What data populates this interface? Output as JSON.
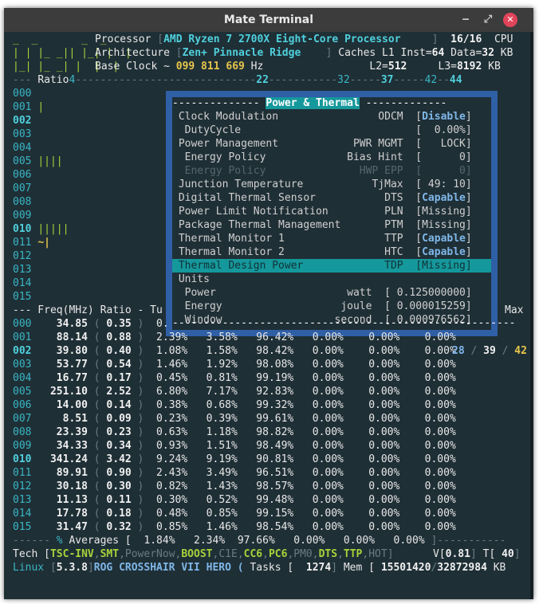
{
  "window": {
    "title": "Mate Terminal"
  },
  "header": {
    "logo": [
      "_  _       _  _",
      "| | |_ _|| |_| |  |",
      "|_| |_ _| |  |  |"
    ],
    "processor_label": "Processor",
    "processor": "AMD Ryzen 7 2700X Eight-Core Processor",
    "threads": "16/16",
    "cpu_label": "CPU",
    "arch_label": "Architecture",
    "arch": "Zen+ Pinnacle Ridge",
    "caches_label": "Caches L1 Inst=",
    "l1i": "64",
    "data_label": "Data=",
    "l1d": "32",
    "kb": "KB",
    "clock_label": "Base Clock ~",
    "clock": "099 811 669",
    "hz": "Hz",
    "l2_label": "L2=",
    "l2": "512",
    "l3_label": "L3=",
    "l3": "8192"
  },
  "ratio_bar": {
    "label": "Ratio",
    "r4": "4",
    "r22": "22",
    "r32": "32",
    "r37": "37",
    "r42": "42",
    "r44": "44"
  },
  "core_rows": [
    {
      "id": "000",
      "bar": ""
    },
    {
      "id": "001",
      "bar": "|"
    },
    {
      "id": "002",
      "bar": ""
    },
    {
      "id": "003",
      "bar": ""
    },
    {
      "id": "004",
      "bar": ""
    },
    {
      "id": "005",
      "bar": "||||"
    },
    {
      "id": "006",
      "bar": ""
    },
    {
      "id": "007",
      "bar": ""
    },
    {
      "id": "008",
      "bar": ""
    },
    {
      "id": "009",
      "bar": ""
    },
    {
      "id": "010",
      "bar": "|||||"
    },
    {
      "id": "011",
      "bar": "~|"
    },
    {
      "id": "012",
      "bar": ""
    },
    {
      "id": "013",
      "bar": ""
    },
    {
      "id": "014",
      "bar": ""
    },
    {
      "id": "015",
      "bar": ""
    }
  ],
  "panel": {
    "title": "Power & Thermal",
    "rows": [
      {
        "label": "Clock Modulation",
        "key": "ODCM",
        "value": "Disable",
        "type": "cap"
      },
      {
        "label": " DutyCycle",
        "key": "",
        "value": "  0.00%",
        "type": "plain"
      },
      {
        "label": "Power Management",
        "key": "PWR MGMT",
        "value": "   LOCK",
        "type": "plain"
      },
      {
        "label": " Energy Policy",
        "key": "Bias Hint",
        "value": "      0",
        "type": "plain"
      },
      {
        "label": " Energy Policy",
        "key": "HWP EPP",
        "value": "      0",
        "type": "dim"
      },
      {
        "label": "Junction Temperature",
        "key": "TjMax",
        "value": " 49: 10",
        "type": "plain"
      },
      {
        "label": "Digital Thermal Sensor",
        "key": "DTS",
        "value": "Capable",
        "type": "cap"
      },
      {
        "label": "Power Limit Notification",
        "key": "PLN",
        "value": "Missing",
        "type": "plain"
      },
      {
        "label": "Package Thermal Management",
        "key": "PTM",
        "value": "Missing",
        "type": "plain"
      },
      {
        "label": "Thermal Monitor 1",
        "key": "TTP",
        "value": "Capable",
        "type": "cap"
      },
      {
        "label": "Thermal Monitor 2",
        "key": "HTC",
        "value": "Capable",
        "type": "cap"
      },
      {
        "label": "Thermal Design Power",
        "key": "TDP",
        "value": "Missing",
        "type": "sel"
      }
    ],
    "units_label": "Units",
    "units": [
      {
        "label": " Power",
        "unit": "watt",
        "value": " 0.125000000"
      },
      {
        "label": " Energy",
        "unit": "joule",
        "value": " 0.000015259"
      },
      {
        "label": " Window",
        "unit": "second",
        "value": " 0.000976562"
      }
    ]
  },
  "freq_header": {
    "text": "--- Freq(MHz) Ratio - Tu",
    "max": "Max"
  },
  "freq_rows": [
    {
      "id": "000",
      "mhz": "34.85",
      "ratio": "0.35",
      "c0": "0.",
      "c1": "",
      "c3": "",
      "c6": "",
      "c7": "",
      "p1": "",
      "p2": "",
      "p3": ""
    },
    {
      "id": "001",
      "mhz": "88.14",
      "ratio": "0.88",
      "c0": "2.39%",
      "c1": "3.58%",
      "c3": "96.42%",
      "c6": "0.00%",
      "c7": "0.00%",
      "p1": "0.00%"
    },
    {
      "id": "002",
      "mhz": "39.80",
      "ratio": "0.40",
      "c0": "1.08%",
      "c1": "1.58%",
      "c3": "98.42%",
      "c6": "0.00%",
      "c7": "0.00%",
      "p1": "0.00%"
    },
    {
      "id": "003",
      "mhz": "53.77",
      "ratio": "0.54",
      "c0": "1.46%",
      "c1": "1.92%",
      "c3": "98.08%",
      "c6": "0.00%",
      "c7": "0.00%",
      "p1": "0.00%"
    },
    {
      "id": "004",
      "mhz": "16.77",
      "ratio": "0.17",
      "c0": "0.45%",
      "c1": "0.81%",
      "c3": "99.19%",
      "c6": "0.00%",
      "c7": "0.00%",
      "p1": "0.00%"
    },
    {
      "id": "005",
      "mhz": "251.10",
      "ratio": "2.52",
      "c0": "6.80%",
      "c1": "7.17%",
      "c3": "92.83%",
      "c6": "0.00%",
      "c7": "0.00%",
      "p1": "0.00%"
    },
    {
      "id": "006",
      "mhz": "14.00",
      "ratio": "0.14",
      "c0": "0.38%",
      "c1": "0.68%",
      "c3": "99.32%",
      "c6": "0.00%",
      "c7": "0.00%",
      "p1": "0.00%"
    },
    {
      "id": "007",
      "mhz": "8.51",
      "ratio": "0.09",
      "c0": "0.23%",
      "c1": "0.39%",
      "c3": "99.61%",
      "c6": "0.00%",
      "c7": "0.00%",
      "p1": "0.00%"
    },
    {
      "id": "008",
      "mhz": "23.39",
      "ratio": "0.23",
      "c0": "0.63%",
      "c1": "1.18%",
      "c3": "98.82%",
      "c6": "0.00%",
      "c7": "0.00%",
      "p1": "0.00%"
    },
    {
      "id": "009",
      "mhz": "34.33",
      "ratio": "0.34",
      "c0": "0.93%",
      "c1": "1.51%",
      "c3": "98.49%",
      "c6": "0.00%",
      "c7": "0.00%",
      "p1": "0.00%"
    },
    {
      "id": "010",
      "mhz": "341.24",
      "ratio": "3.42",
      "c0": "9.24%",
      "c1": "9.19%",
      "c3": "90.81%",
      "c6": "0.00%",
      "c7": "0.00%",
      "p1": "0.00%"
    },
    {
      "id": "011",
      "mhz": "89.91",
      "ratio": "0.90",
      "c0": "2.43%",
      "c1": "3.49%",
      "c3": "96.51%",
      "c6": "0.00%",
      "c7": "0.00%",
      "p1": "0.00%"
    },
    {
      "id": "012",
      "mhz": "30.18",
      "ratio": "0.30",
      "c0": "0.82%",
      "c1": "1.43%",
      "c3": "98.57%",
      "c6": "0.00%",
      "c7": "0.00%",
      "p1": "0.00%"
    },
    {
      "id": "013",
      "mhz": "11.13",
      "ratio": "0.11",
      "c0": "0.30%",
      "c1": "0.52%",
      "c3": "99.48%",
      "c6": "0.00%",
      "c7": "0.00%",
      "p1": "0.00%"
    },
    {
      "id": "014",
      "mhz": "17.78",
      "ratio": "0.18",
      "c0": "0.48%",
      "c1": "0.85%",
      "c3": "99.15%",
      "c6": "0.00%",
      "c7": "0.00%",
      "p1": "0.00%"
    },
    {
      "id": "015",
      "mhz": "31.47",
      "ratio": "0.32",
      "c0": "0.85%",
      "c1": "1.46%",
      "c3": "98.54%",
      "c6": "0.00%",
      "c7": "0.00%",
      "p1": "0.00%"
    }
  ],
  "temps": {
    "min": "28",
    "cur": "39",
    "max": "42"
  },
  "averages": {
    "label": "Averages [",
    "pct": "%",
    "c0": "1.84%",
    "c1": "2.34%",
    "c3": "97.66%",
    "c6": "0.00%",
    "c7": "0.00%",
    "p1": "0.00%"
  },
  "tech": {
    "label": "Tech [",
    "items": [
      {
        "t": "TSC-INV",
        "on": true
      },
      {
        "t": "SMT",
        "on": true
      },
      {
        "t": "PowerNow",
        "on": false
      },
      {
        "t": "BOOST",
        "on": true
      },
      {
        "t": "C1E",
        "on": false
      },
      {
        "t": "CC6",
        "on": true
      },
      {
        "t": "PC6",
        "on": true
      },
      {
        "t": "PM0",
        "on": false
      },
      {
        "t": "DTS",
        "on": true
      },
      {
        "t": "TTP",
        "on": true
      },
      {
        "t": "HOT",
        "on": false
      }
    ],
    "voltage_label": "V[",
    "voltage": "0.81",
    "temp_label": "T[",
    "temp": "40"
  },
  "footer": {
    "os": "Linux",
    "kernel": "5.3.8",
    "board": "ROG CROSSHAIR VII HERO (",
    "tasks_label": "Tasks [",
    "tasks": "1274",
    "mem_label": "Mem [",
    "mem_used": "15501420",
    "mem_total": "32872984",
    "kb": "KB"
  }
}
